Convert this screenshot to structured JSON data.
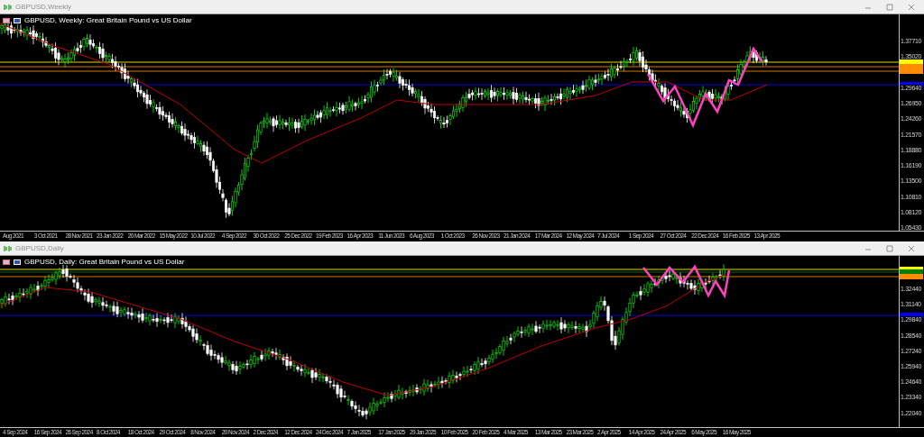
{
  "windows": [
    {
      "title": "GBPUSD,Weekly",
      "chart_header": "GBPUSD, Weekly:  Great Britain Pound vs US Dollar",
      "price_axis": [
        "1.37710",
        "1.35020",
        "1.29640",
        "1.26950",
        "1.24260",
        "1.21570",
        "1.18880",
        "1.16190",
        "1.13500",
        "1.10810",
        "1.08120",
        "1.05430"
      ],
      "time_axis": [
        "Aug 2021",
        "3 Oct 2021",
        "28 Nov 2021",
        "23 Jan 2022",
        "20 Mar 2022",
        "15 May 2022",
        "10 Jul 2022",
        "4 Sep 2022",
        "30 Oct 2022",
        "25 Dec 2022",
        "19 Feb 2023",
        "16 Apr 2023",
        "11 Jun 2023",
        "6 Aug 2023",
        "1 Oct 2023",
        "26 Nov 2023",
        "21 Jan 2024",
        "17 Mar 2024",
        "12 May 2024",
        "7 Jul 2024",
        "1 Sep 2024",
        "27 Oct 2024",
        "22 Dec 2024",
        "16 Feb 2025",
        "13 Apr 2025"
      ],
      "level_lines": [
        {
          "color": "#ffff00"
        },
        {
          "color": "#ff8c00"
        },
        {
          "color": "#ff8c00"
        },
        {
          "color": "#0000ff"
        }
      ]
    },
    {
      "title": "GBPUSD,Daily",
      "chart_header": "GBPUSD, Daily:  Great Britain Pound vs US Dollar",
      "price_axis": [
        "1.32440",
        "1.31140",
        "1.29840",
        "1.28540",
        "1.27240",
        "1.25940",
        "1.24640",
        "1.23340",
        "1.22040"
      ],
      "time_axis": [
        "4 Sep 2024",
        "16 Sep 2024",
        "26 Sep 2024",
        "8 Oct 2024",
        "18 Oct 2024",
        "29 Oct 2024",
        "8 Nov 2024",
        "20 Nov 2024",
        "2 Dec 2024",
        "12 Dec 2024",
        "24 Dec 2024",
        "7 Jan 2025",
        "17 Jan 2025",
        "29 Jan 2025",
        "10 Feb 2025",
        "20 Feb 2025",
        "4 Mar 2025",
        "13 Mar 2025",
        "23 Mar 2025",
        "2 Apr 2025",
        "14 Apr 2025",
        "24 Apr 2025",
        "6 May 2025",
        "16 May 2025"
      ],
      "level_lines": [
        {
          "color": "#ffff00"
        },
        {
          "color": "#008000"
        },
        {
          "color": "#ff8c00"
        },
        {
          "color": "#0000ff"
        }
      ]
    }
  ]
}
